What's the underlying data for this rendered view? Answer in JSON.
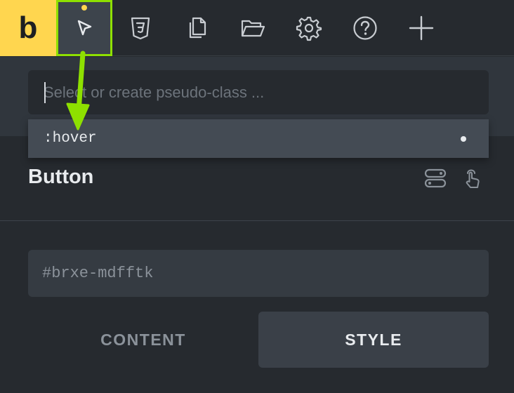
{
  "toolbar": {
    "logo": "b",
    "tools": [
      {
        "icon": "cursor-icon",
        "active": true
      },
      {
        "icon": "css3-icon"
      },
      {
        "icon": "pages-icon"
      },
      {
        "icon": "folder-icon"
      },
      {
        "icon": "gear-icon"
      },
      {
        "icon": "help-icon"
      },
      {
        "icon": "plus-icon"
      }
    ]
  },
  "pseudo": {
    "placeholder": "Select or create pseudo-class ...",
    "options": [
      ":hover"
    ]
  },
  "element": {
    "title": "Button",
    "id": "#brxe-mdfftk"
  },
  "tabs": {
    "content": "CONTENT",
    "style": "STYLE",
    "active": "STYLE"
  },
  "colors": {
    "accent": "#ffd64f",
    "annotation": "#8ee000",
    "background": "#262a2f"
  }
}
